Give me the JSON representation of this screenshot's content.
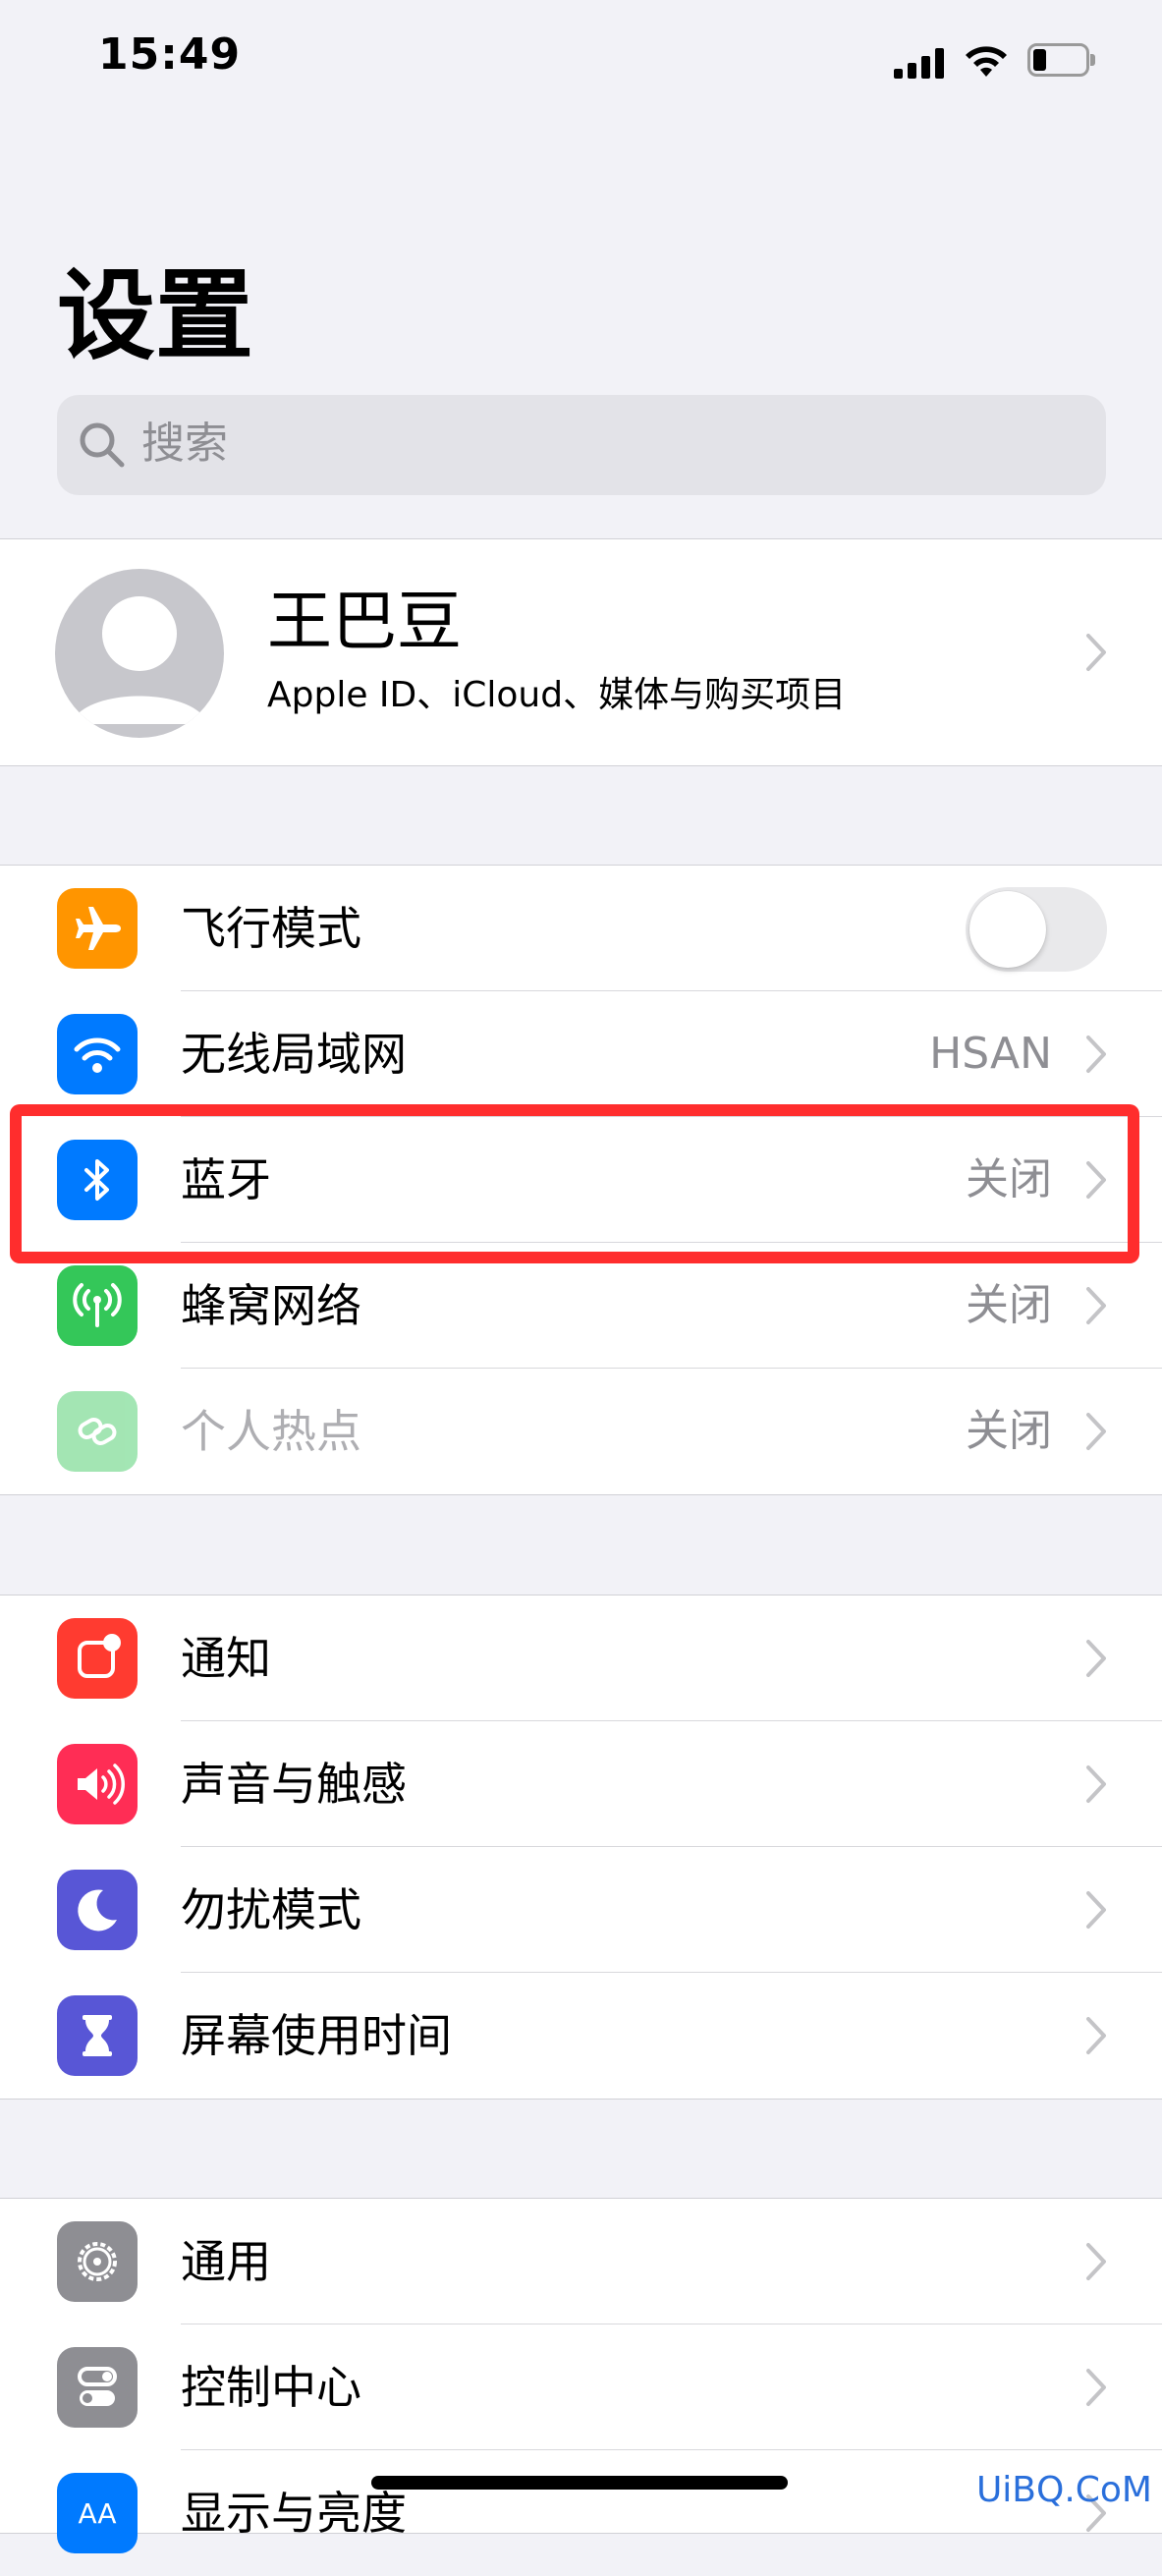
{
  "status_bar": {
    "time": "15:49"
  },
  "header": {
    "title": "设置",
    "search_placeholder": "搜索"
  },
  "profile": {
    "name": "王巴豆",
    "subtitle": "Apple ID、iCloud、媒体与购买项目"
  },
  "group1": [
    {
      "label": "飞行模式",
      "icon": "airplane-icon",
      "color": "#ff9500",
      "toggle": false
    },
    {
      "label": "无线局域网",
      "icon": "wifi-icon",
      "color": "#007aff",
      "value": "HSAN"
    },
    {
      "label": "蓝牙",
      "icon": "bluetooth-icon",
      "color": "#007aff",
      "value": "关闭"
    },
    {
      "label": "蜂窝网络",
      "icon": "cellular-icon",
      "color": "#34c759",
      "value": "关闭"
    },
    {
      "label": "个人热点",
      "icon": "hotspot-icon",
      "color": "#34c759",
      "value": "关闭",
      "disabled": true
    }
  ],
  "group2": [
    {
      "label": "通知",
      "icon": "notifications-icon",
      "color": "#ff3b30"
    },
    {
      "label": "声音与触感",
      "icon": "sound-icon",
      "color": "#ff2d55"
    },
    {
      "label": "勿扰模式",
      "icon": "moon-icon",
      "color": "#5856d6"
    },
    {
      "label": "屏幕使用时间",
      "icon": "hourglass-icon",
      "color": "#5856d6"
    }
  ],
  "group3": [
    {
      "label": "通用",
      "icon": "gear-icon",
      "color": "#8e8e93"
    },
    {
      "label": "控制中心",
      "icon": "switches-icon",
      "color": "#8e8e93"
    },
    {
      "label": "显示与亮度",
      "icon": "display-icon",
      "color": "#007aff"
    }
  ],
  "watermark": "UiBQ.CoM"
}
